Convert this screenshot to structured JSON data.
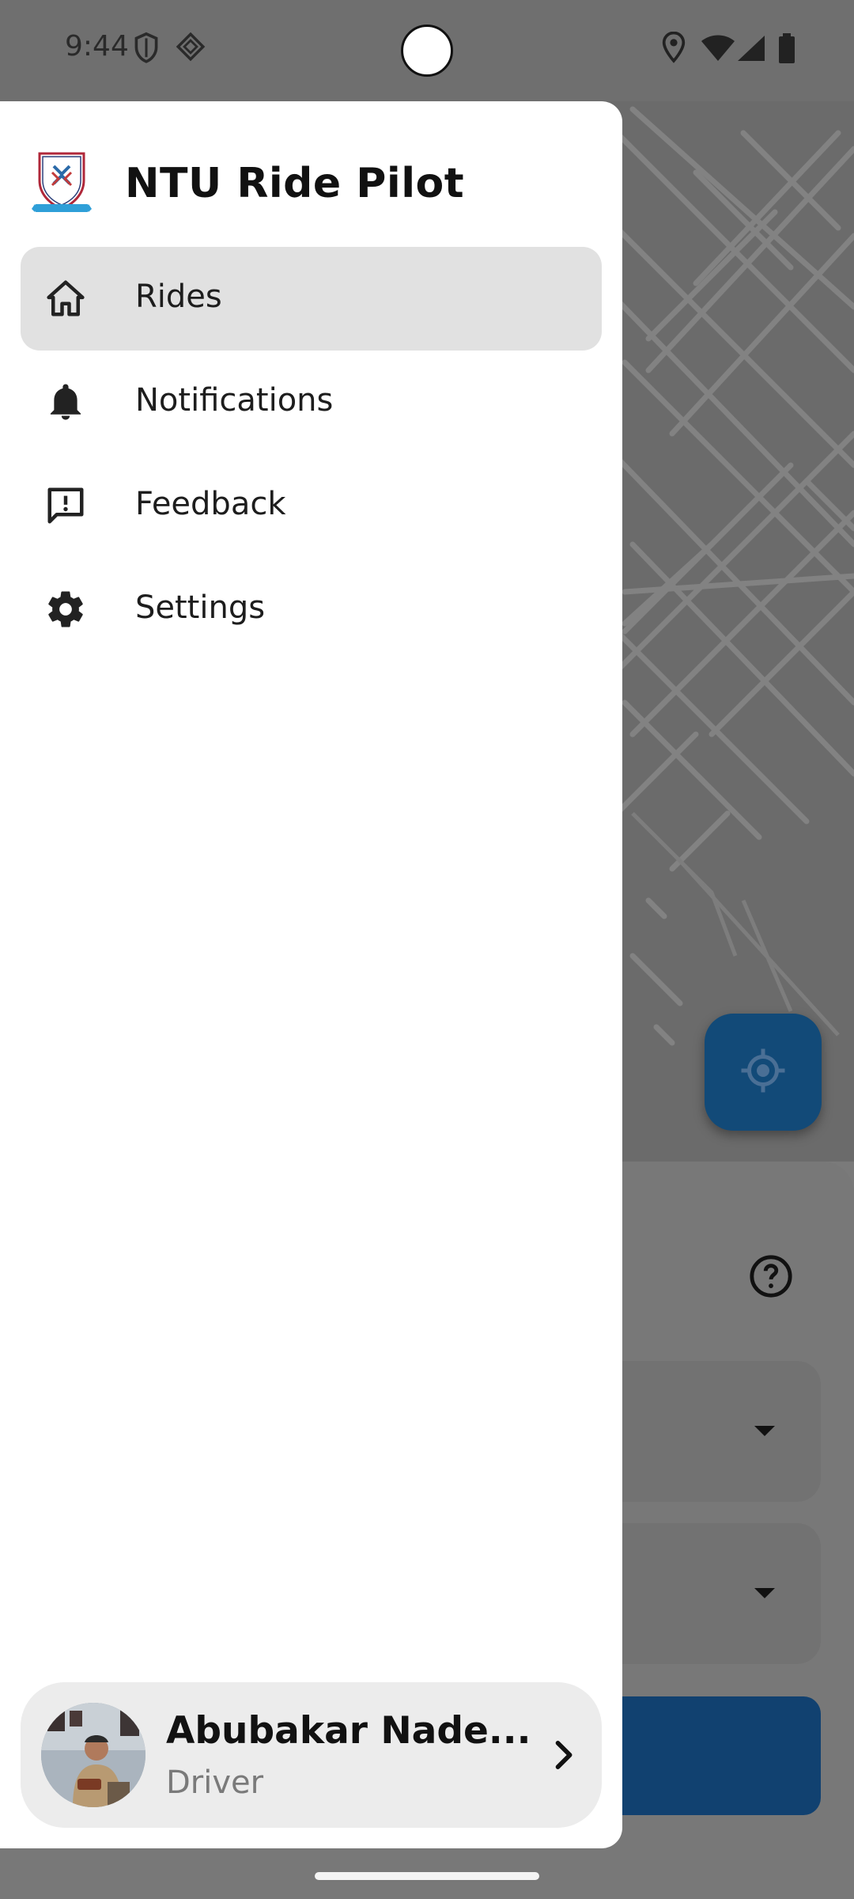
{
  "status_bar": {
    "time": "9:44",
    "left_icons": [
      "shield-icon",
      "vpn-diamond-icon"
    ],
    "right_icons": [
      "location-icon",
      "wifi-icon",
      "signal-icon",
      "battery-icon"
    ]
  },
  "drawer": {
    "app_title": "NTU Ride Pilot",
    "logo_icon": "ntu-crest-icon",
    "items": [
      {
        "label": "Rides",
        "icon": "home-icon",
        "active": true
      },
      {
        "label": "Notifications",
        "icon": "bell-icon",
        "active": false
      },
      {
        "label": "Feedback",
        "icon": "feedback-icon",
        "active": false
      },
      {
        "label": "Settings",
        "icon": "gear-icon",
        "active": false
      }
    ],
    "profile": {
      "name": "Abubakar Nade...",
      "role": "Driver"
    }
  },
  "background": {
    "locate_icon": "my-location-icon",
    "help_icon": "help-circle-icon"
  },
  "colors": {
    "accent": "#124a78",
    "drawer_bg": "#ffffff",
    "active_item_bg": "#e1e1e1",
    "scrim": "#7a7a7a"
  }
}
